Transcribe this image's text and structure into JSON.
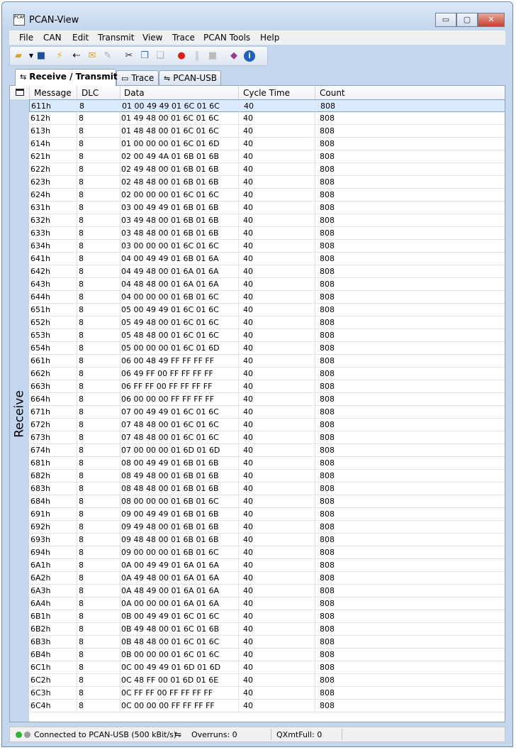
{
  "window": {
    "title": "PCAN-View",
    "icon_text": "PCAN",
    "controls": {
      "minimize": "▭",
      "maximize": "▢",
      "close": "✕"
    }
  },
  "menu": [
    "File",
    "CAN",
    "Edit",
    "Transmit",
    "View",
    "Trace",
    "PCAN Tools",
    "Help"
  ],
  "toolbar_icons": [
    "open-folder-icon",
    "save-icon",
    "connect-icon",
    "disconnect-icon",
    "new-message-icon",
    "edit-message-icon",
    "cut-icon",
    "copy-icon",
    "paste-icon",
    "record-icon",
    "pause-icon",
    "stop-icon",
    "help-book-icon",
    "info-icon"
  ],
  "tabs": [
    {
      "label": "Receive / Transmit",
      "icon": "receive-transmit-icon"
    },
    {
      "label": "Trace",
      "icon": "trace-icon"
    },
    {
      "label": "PCAN-USB",
      "icon": "usb-icon"
    }
  ],
  "columns": [
    "Message",
    "DLC",
    "Data",
    "Cycle Time",
    "Count"
  ],
  "side_label": "Receive",
  "messages": [
    [
      "611h",
      "8",
      "01 00 49 49 01 6C 01 6C",
      "40",
      "808"
    ],
    [
      "612h",
      "8",
      "01 49 48 00 01 6C 01 6C",
      "40",
      "808"
    ],
    [
      "613h",
      "8",
      "01 48 48 00 01 6C 01 6C",
      "40",
      "808"
    ],
    [
      "614h",
      "8",
      "01 00 00 00 01 6C 01 6D",
      "40",
      "808"
    ],
    [
      "621h",
      "8",
      "02 00 49 4A 01 6B 01 6B",
      "40",
      "808"
    ],
    [
      "622h",
      "8",
      "02 49 48 00 01 6B 01 6B",
      "40",
      "808"
    ],
    [
      "623h",
      "8",
      "02 48 48 00 01 6B 01 6B",
      "40",
      "808"
    ],
    [
      "624h",
      "8",
      "02 00 00 00 01 6C 01 6C",
      "40",
      "808"
    ],
    [
      "631h",
      "8",
      "03 00 49 49 01 6B 01 6B",
      "40",
      "808"
    ],
    [
      "632h",
      "8",
      "03 49 48 00 01 6B 01 6B",
      "40",
      "808"
    ],
    [
      "633h",
      "8",
      "03 48 48 00 01 6B 01 6B",
      "40",
      "808"
    ],
    [
      "634h",
      "8",
      "03 00 00 00 01 6C 01 6C",
      "40",
      "808"
    ],
    [
      "641h",
      "8",
      "04 00 49 49 01 6B 01 6A",
      "40",
      "808"
    ],
    [
      "642h",
      "8",
      "04 49 48 00 01 6A 01 6A",
      "40",
      "808"
    ],
    [
      "643h",
      "8",
      "04 48 48 00 01 6A 01 6A",
      "40",
      "808"
    ],
    [
      "644h",
      "8",
      "04 00 00 00 01 6B 01 6C",
      "40",
      "808"
    ],
    [
      "651h",
      "8",
      "05 00 49 49 01 6C 01 6C",
      "40",
      "808"
    ],
    [
      "652h",
      "8",
      "05 49 48 00 01 6C 01 6C",
      "40",
      "808"
    ],
    [
      "653h",
      "8",
      "05 48 48 00 01 6C 01 6C",
      "40",
      "808"
    ],
    [
      "654h",
      "8",
      "05 00 00 00 01 6C 01 6D",
      "40",
      "808"
    ],
    [
      "661h",
      "8",
      "06 00 48 49 FF FF FF FF",
      "40",
      "808"
    ],
    [
      "662h",
      "8",
      "06 49 FF 00 FF FF FF FF",
      "40",
      "808"
    ],
    [
      "663h",
      "8",
      "06 FF FF 00 FF FF FF FF",
      "40",
      "808"
    ],
    [
      "664h",
      "8",
      "06 00 00 00 FF FF FF FF",
      "40",
      "808"
    ],
    [
      "671h",
      "8",
      "07 00 49 49 01 6C 01 6C",
      "40",
      "808"
    ],
    [
      "672h",
      "8",
      "07 48 48 00 01 6C 01 6C",
      "40",
      "808"
    ],
    [
      "673h",
      "8",
      "07 48 48 00 01 6C 01 6C",
      "40",
      "808"
    ],
    [
      "674h",
      "8",
      "07 00 00 00 01 6D 01 6D",
      "40",
      "808"
    ],
    [
      "681h",
      "8",
      "08 00 49 49 01 6B 01 6B",
      "40",
      "808"
    ],
    [
      "682h",
      "8",
      "08 49 48 00 01 6B 01 6B",
      "40",
      "808"
    ],
    [
      "683h",
      "8",
      "08 48 48 00 01 6B 01 6B",
      "40",
      "808"
    ],
    [
      "684h",
      "8",
      "08 00 00 00 01 6B 01 6C",
      "40",
      "808"
    ],
    [
      "691h",
      "8",
      "09 00 49 49 01 6B 01 6B",
      "40",
      "808"
    ],
    [
      "692h",
      "8",
      "09 49 48 00 01 6B 01 6B",
      "40",
      "808"
    ],
    [
      "693h",
      "8",
      "09 48 48 00 01 6B 01 6B",
      "40",
      "808"
    ],
    [
      "694h",
      "8",
      "09 00 00 00 01 6B 01 6C",
      "40",
      "808"
    ],
    [
      "6A1h",
      "8",
      "0A 00 49 49 01 6A 01 6A",
      "40",
      "808"
    ],
    [
      "6A2h",
      "8",
      "0A 49 48 00 01 6A 01 6A",
      "40",
      "808"
    ],
    [
      "6A3h",
      "8",
      "0A 48 49 00 01 6A 01 6A",
      "40",
      "808"
    ],
    [
      "6A4h",
      "8",
      "0A 00 00 00 01 6A 01 6A",
      "40",
      "808"
    ],
    [
      "6B1h",
      "8",
      "0B 00 49 49 01 6C 01 6C",
      "40",
      "808"
    ],
    [
      "6B2h",
      "8",
      "0B 49 48 00 01 6C 01 6B",
      "40",
      "808"
    ],
    [
      "6B3h",
      "8",
      "0B 48 48 00 01 6C 01 6C",
      "40",
      "808"
    ],
    [
      "6B4h",
      "8",
      "0B 00 00 00 01 6C 01 6C",
      "40",
      "808"
    ],
    [
      "6C1h",
      "8",
      "0C 00 49 49 01 6D 01 6D",
      "40",
      "808"
    ],
    [
      "6C2h",
      "8",
      "0C 48 FF 00 01 6D 01 6E",
      "40",
      "808"
    ],
    [
      "6C3h",
      "8",
      "0C FF FF 00 FF FF FF FF",
      "40",
      "808"
    ],
    [
      "6C4h",
      "8",
      "0C 00 00 00 FF FF FF FF",
      "40",
      "808"
    ]
  ],
  "selected_index": 0,
  "status": {
    "connection": "Connected to PCAN-USB (500 kBit/s)",
    "overruns": "Overruns: 0",
    "qxmtfull": "QXmtFull: 0"
  },
  "colors": {
    "led_green": "#2db52d",
    "led_gray": "#9a9a9a",
    "record_red": "#e02020",
    "selection": "#dcebfc"
  }
}
